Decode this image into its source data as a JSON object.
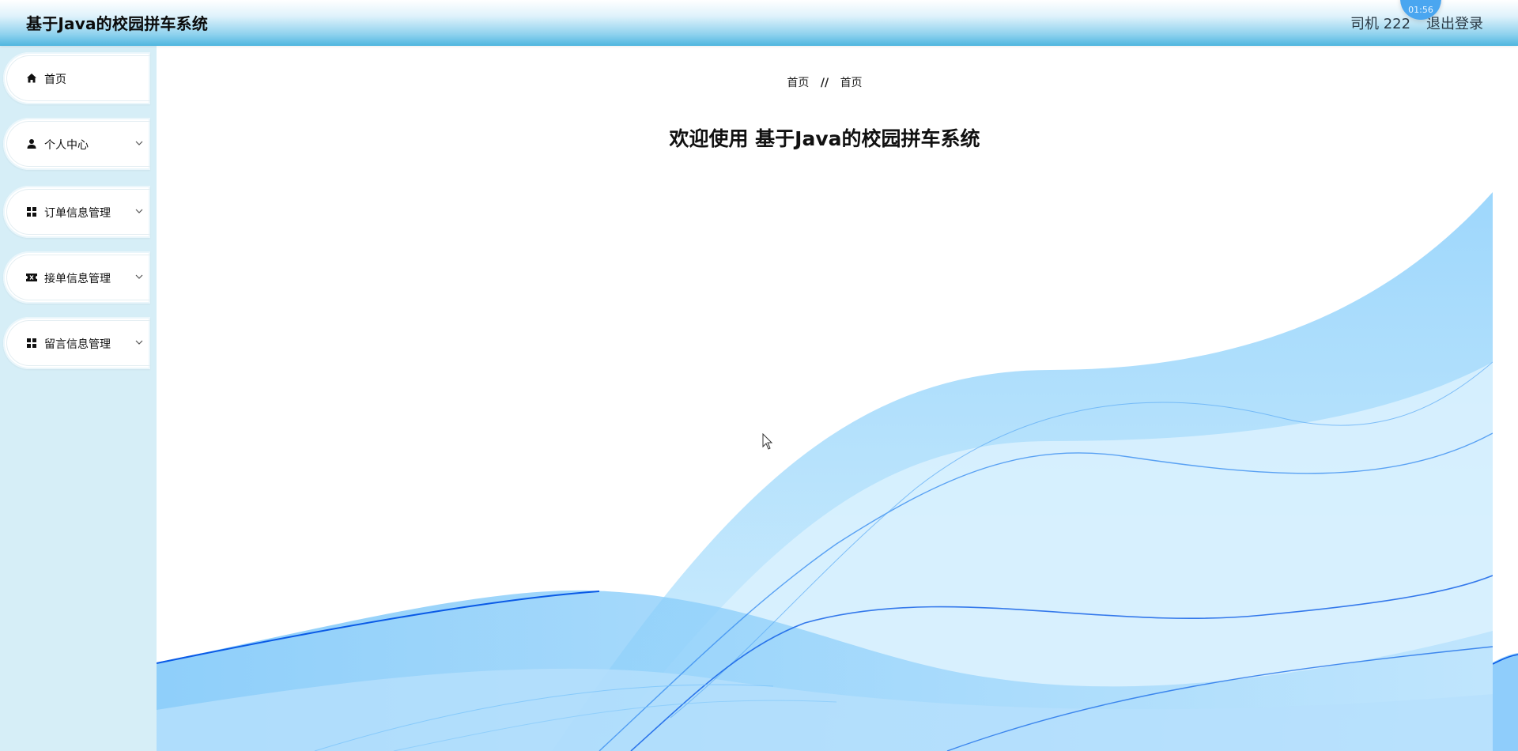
{
  "header": {
    "title": "基于Java的校园拼车系统",
    "user": "司机 222",
    "logout_label": "退出登录",
    "bubble_text": "01:56"
  },
  "sidebar": {
    "items": [
      {
        "label": "首页",
        "icon": "home-icon",
        "has_submenu": false
      },
      {
        "label": "个人中心",
        "icon": "user-icon",
        "has_submenu": true
      },
      {
        "label": "订单信息管理",
        "icon": "grid-icon",
        "has_submenu": true
      },
      {
        "label": "接单信息管理",
        "icon": "ticket-icon",
        "has_submenu": true
      },
      {
        "label": "留言信息管理",
        "icon": "grid-icon",
        "has_submenu": true
      }
    ]
  },
  "main": {
    "breadcrumb": [
      "首页",
      "首页"
    ],
    "breadcrumb_separator": "//",
    "welcome_text": "欢迎使用 基于Java的校园拼车系统"
  },
  "colors": {
    "sidebar_bg": "#d6eef7",
    "header_accent": "#4fb6df",
    "wave_dark": "#0a5ae6",
    "wave_light": "#9fd3fb"
  }
}
